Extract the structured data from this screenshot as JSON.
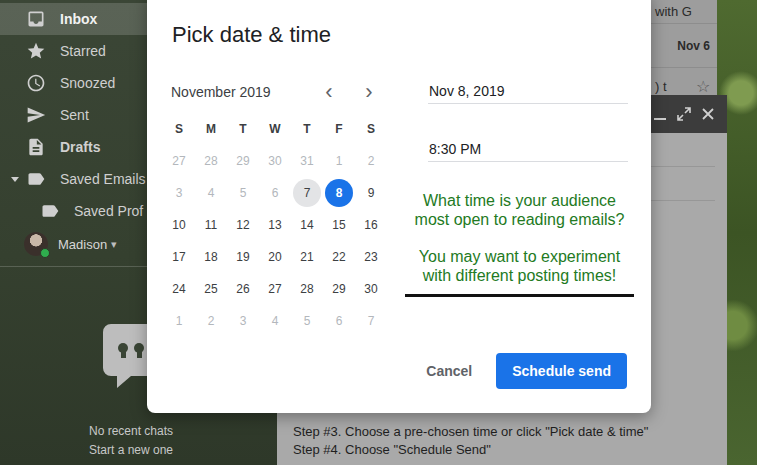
{
  "sidebar": {
    "items": [
      {
        "label": "Inbox",
        "kind": "nav",
        "selected": true,
        "bold": true
      },
      {
        "label": "Starred",
        "kind": "nav",
        "selected": false,
        "bold": false
      },
      {
        "label": "Snoozed",
        "kind": "nav",
        "selected": false,
        "bold": false
      },
      {
        "label": "Sent",
        "kind": "nav",
        "selected": false,
        "bold": false
      },
      {
        "label": "Drafts",
        "kind": "nav",
        "selected": false,
        "bold": true
      },
      {
        "label": "Saved Emails",
        "kind": "group",
        "selected": false,
        "bold": false,
        "expanded": true
      },
      {
        "label": "Saved Prof",
        "kind": "child",
        "selected": false,
        "bold": false
      }
    ],
    "user": {
      "name": "Madison",
      "caret": "▾",
      "online": true
    },
    "chat": {
      "empty": "No recent chats",
      "action": "Start a new one"
    }
  },
  "mail_list": {
    "rows": [
      {
        "text": "with G",
        "date": "",
        "bold": false,
        "icon": ""
      },
      {
        "text": "",
        "date": "Nov 6",
        "bold": true,
        "icon": ""
      },
      {
        "text": ") t",
        "date": "",
        "bold": false,
        "icon": "☆"
      }
    ]
  },
  "compose": {
    "lines": [
      "Step #3. Choose a pre-chosen time or click \"Pick date & time\"",
      "Step #4. Choose \"Schedule Send\""
    ]
  },
  "dialog": {
    "title": "Pick date & time",
    "month": "November 2019",
    "nav": [
      "‹",
      "›"
    ],
    "weekdays": [
      "S",
      "M",
      "T",
      "W",
      "T",
      "F",
      "S"
    ],
    "weeks": [
      [
        {
          "day": "27",
          "muted": true,
          "today": false,
          "selected": false
        },
        {
          "day": "28",
          "muted": true,
          "today": false,
          "selected": false
        },
        {
          "day": "29",
          "muted": true,
          "today": false,
          "selected": false
        },
        {
          "day": "30",
          "muted": true,
          "today": false,
          "selected": false
        },
        {
          "day": "31",
          "muted": true,
          "today": false,
          "selected": false
        },
        {
          "day": "1",
          "muted": true,
          "today": false,
          "selected": false
        },
        {
          "day": "2",
          "muted": true,
          "today": false,
          "selected": false
        }
      ],
      [
        {
          "day": "3",
          "muted": true,
          "today": false,
          "selected": false
        },
        {
          "day": "4",
          "muted": true,
          "today": false,
          "selected": false
        },
        {
          "day": "5",
          "muted": true,
          "today": false,
          "selected": false
        },
        {
          "day": "6",
          "muted": true,
          "today": false,
          "selected": false
        },
        {
          "day": "7",
          "muted": false,
          "today": true,
          "selected": false
        },
        {
          "day": "8",
          "muted": false,
          "today": false,
          "selected": true
        },
        {
          "day": "9",
          "muted": false,
          "today": false,
          "selected": false
        }
      ],
      [
        {
          "day": "10",
          "muted": false,
          "today": false,
          "selected": false
        },
        {
          "day": "11",
          "muted": false,
          "today": false,
          "selected": false
        },
        {
          "day": "12",
          "muted": false,
          "today": false,
          "selected": false
        },
        {
          "day": "13",
          "muted": false,
          "today": false,
          "selected": false
        },
        {
          "day": "14",
          "muted": false,
          "today": false,
          "selected": false
        },
        {
          "day": "15",
          "muted": false,
          "today": false,
          "selected": false
        },
        {
          "day": "16",
          "muted": false,
          "today": false,
          "selected": false
        }
      ],
      [
        {
          "day": "17",
          "muted": false,
          "today": false,
          "selected": false
        },
        {
          "day": "18",
          "muted": false,
          "today": false,
          "selected": false
        },
        {
          "day": "19",
          "muted": false,
          "today": false,
          "selected": false
        },
        {
          "day": "20",
          "muted": false,
          "today": false,
          "selected": false
        },
        {
          "day": "21",
          "muted": false,
          "today": false,
          "selected": false
        },
        {
          "day": "22",
          "muted": false,
          "today": false,
          "selected": false
        },
        {
          "day": "23",
          "muted": false,
          "today": false,
          "selected": false
        }
      ],
      [
        {
          "day": "24",
          "muted": false,
          "today": false,
          "selected": false
        },
        {
          "day": "25",
          "muted": false,
          "today": false,
          "selected": false
        },
        {
          "day": "26",
          "muted": false,
          "today": false,
          "selected": false
        },
        {
          "day": "27",
          "muted": false,
          "today": false,
          "selected": false
        },
        {
          "day": "28",
          "muted": false,
          "today": false,
          "selected": false
        },
        {
          "day": "29",
          "muted": false,
          "today": false,
          "selected": false
        },
        {
          "day": "30",
          "muted": false,
          "today": false,
          "selected": false
        }
      ],
      [
        {
          "day": "1",
          "muted": true,
          "today": false,
          "selected": false
        },
        {
          "day": "2",
          "muted": true,
          "today": false,
          "selected": false
        },
        {
          "day": "3",
          "muted": true,
          "today": false,
          "selected": false
        },
        {
          "day": "4",
          "muted": true,
          "today": false,
          "selected": false
        },
        {
          "day": "5",
          "muted": true,
          "today": false,
          "selected": false
        },
        {
          "day": "6",
          "muted": true,
          "today": false,
          "selected": false
        },
        {
          "day": "7",
          "muted": true,
          "today": false,
          "selected": false
        }
      ]
    ],
    "date_field": "Nov 8, 2019",
    "time_field": "8:30 PM",
    "annotation": [
      "What time is your audience most open to reading emails?",
      "You may want to experiment with different posting times!"
    ],
    "buttons": [
      {
        "label": "Cancel",
        "primary": false
      },
      {
        "label": "Schedule send",
        "primary": true
      }
    ]
  }
}
